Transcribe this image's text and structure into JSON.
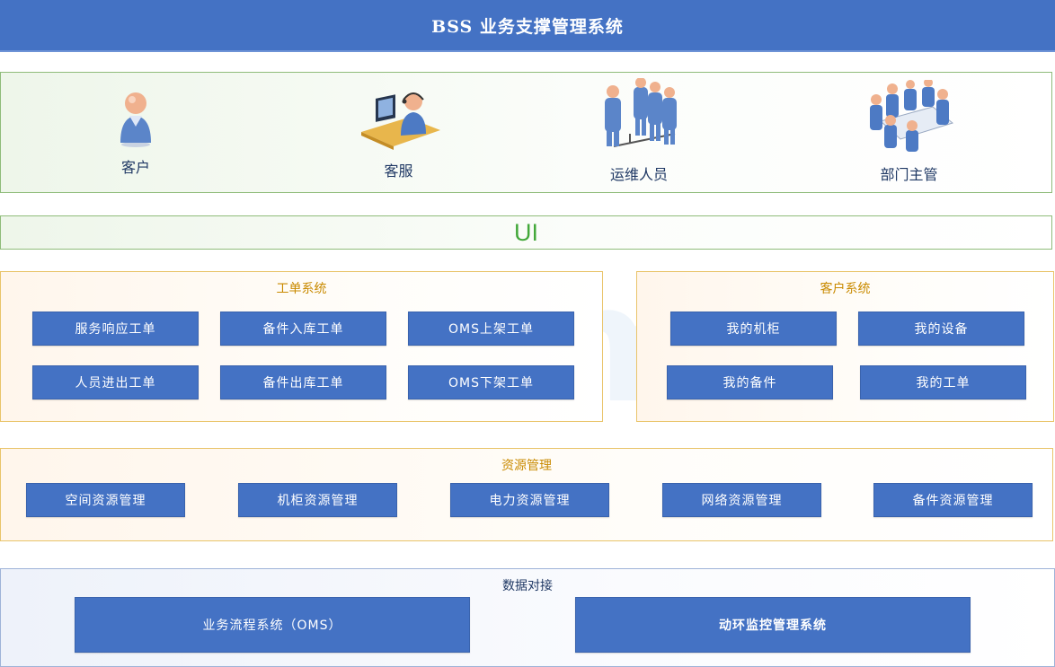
{
  "header": {
    "title": "BSS 业务支撑管理系统"
  },
  "roles": [
    {
      "label": "客户",
      "icon": "customer-icon"
    },
    {
      "label": "客服",
      "icon": "customer-service-icon"
    },
    {
      "label": "运维人员",
      "icon": "operations-staff-icon"
    },
    {
      "label": "部门主管",
      "icon": "department-manager-icon"
    }
  ],
  "ui_band": {
    "label": "UI"
  },
  "work_order_system": {
    "title": "工单系统",
    "items": [
      "服务响应工单",
      "备件入库工单",
      "OMS上架工单",
      "人员进出工单",
      "备件出库工单",
      "OMS下架工单"
    ]
  },
  "customer_system": {
    "title": "客户系统",
    "items": [
      "我的机柜",
      "我的设备",
      "我的备件",
      "我的工单"
    ]
  },
  "resource_management": {
    "title": "资源管理",
    "items": [
      "空间资源管理",
      "机柜资源管理",
      "电力资源管理",
      "网络资源管理",
      "备件资源管理"
    ]
  },
  "data_integration": {
    "title": "数据对接",
    "items": [
      "业务流程系统（OMS）",
      "动环监控管理系统"
    ]
  },
  "watermark": {
    "text": "Lineme"
  },
  "colors": {
    "primary": "#4472c4",
    "accent_green": "#43a83a",
    "group_gold": "#e9c46a"
  }
}
